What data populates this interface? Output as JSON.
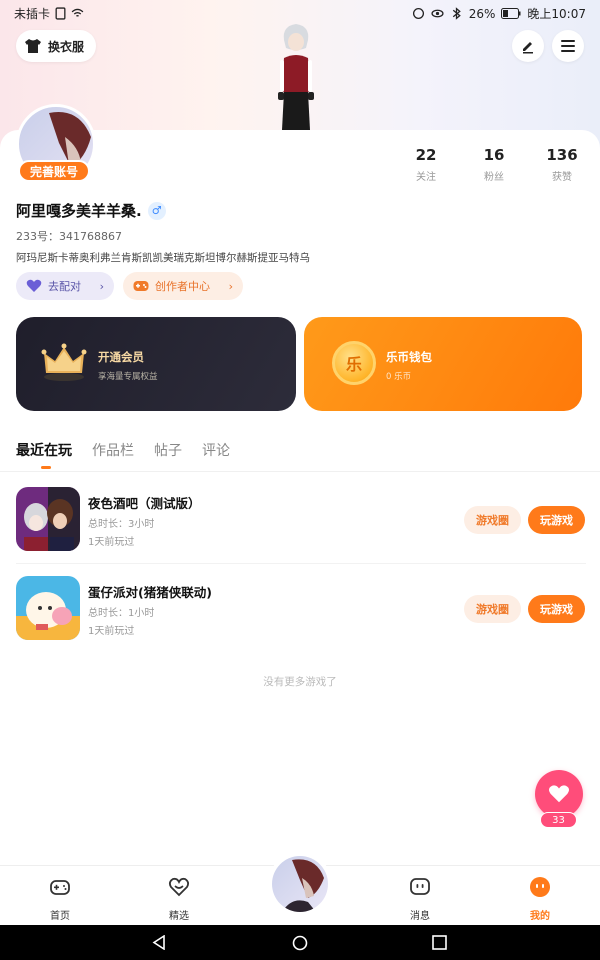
{
  "status_bar": {
    "carrier": "未插卡",
    "battery": "26%",
    "time": "晚上10:07"
  },
  "header": {
    "outfit_label": "换衣服"
  },
  "profile": {
    "complete_badge": "完善账号",
    "username": "阿里嘎多美羊羊桑.",
    "gender_symbol": "♂",
    "uid": "233号：341768867",
    "bio": "阿玛尼斯卡蒂奥利弗兰肯斯凯凯美瑞克斯坦博尔赫斯提亚马特乌",
    "stats": [
      {
        "num": "22",
        "label": "关注"
      },
      {
        "num": "16",
        "label": "粉丝"
      },
      {
        "num": "136",
        "label": "获赞"
      }
    ],
    "pair_label": "去配对",
    "creator_label": "创作者中心"
  },
  "cards": {
    "vip": {
      "title": "开通会员",
      "sub": "享海量专属权益"
    },
    "wallet": {
      "title": "乐币钱包",
      "sub": "0 乐币",
      "coin_glyph": "乐"
    }
  },
  "tabs": [
    "最近在玩",
    "作品栏",
    "帖子",
    "评论"
  ],
  "games": [
    {
      "name": "夜色酒吧（测试版）",
      "duration": "总时长：3小时",
      "last_played": "1天前玩过",
      "circle_label": "游戏圈",
      "play_label": "玩游戏"
    },
    {
      "name": "蛋仔派对(猪猪侠联动)",
      "duration": "总时长：1小时",
      "last_played": "1天前玩过",
      "circle_label": "游戏圈",
      "play_label": "玩游戏"
    }
  ],
  "no_more_text": "没有更多游戏了",
  "like_count": "33",
  "bottom_nav": [
    {
      "label": "首页"
    },
    {
      "label": "精选"
    },
    {
      "label": "消息"
    },
    {
      "label": "我的"
    }
  ],
  "colors": {
    "accent": "#ff7a1a",
    "like": "#ff4d7a"
  }
}
